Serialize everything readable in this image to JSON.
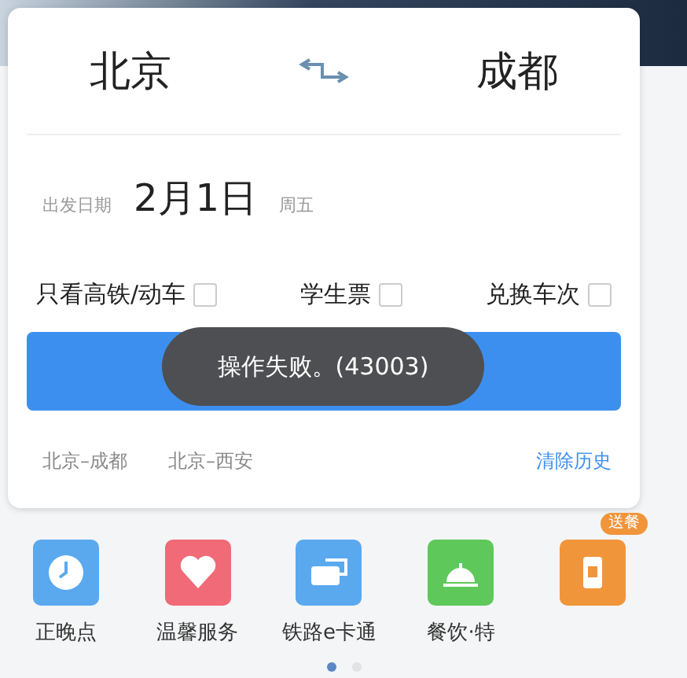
{
  "route": {
    "from": "北京",
    "to": "成都"
  },
  "date": {
    "label": "出发日期",
    "value": "2月1日",
    "weekday": "周五"
  },
  "options": [
    {
      "label": "只看高铁/动车",
      "checked": false
    },
    {
      "label": "学生票",
      "checked": false
    },
    {
      "label": "兑换车次",
      "checked": false
    }
  ],
  "toast": "操作失败。(43003)",
  "history": {
    "items": [
      "北京–成都",
      "北京–西安"
    ],
    "clear": "清除历史"
  },
  "services": [
    {
      "kind": "clock",
      "label": "正晚点",
      "color": "#5aa9ef"
    },
    {
      "kind": "heart",
      "label": "温馨服务",
      "color": "#f06a77"
    },
    {
      "kind": "card",
      "label": "铁路e卡通",
      "color": "#5aa9ef"
    },
    {
      "kind": "bell",
      "label": "餐饮·特",
      "color": "#5ec95a"
    },
    {
      "kind": "phone",
      "color": "#f0953a",
      "badge": "送餐"
    }
  ],
  "pages": [
    {
      "selected": true
    },
    {
      "selected": false
    }
  ]
}
